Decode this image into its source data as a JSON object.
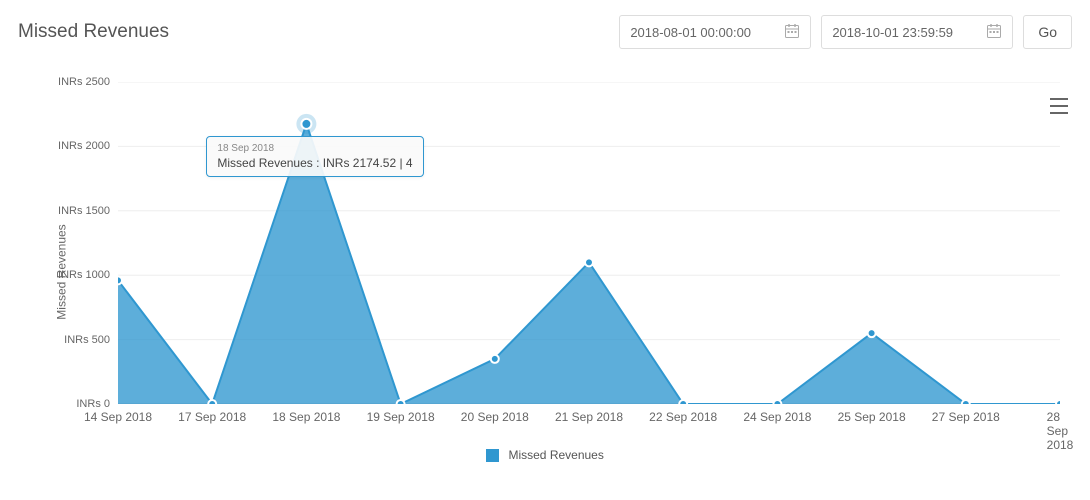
{
  "header": {
    "title": "Missed Revenues"
  },
  "controls": {
    "date_from": "2018-08-01 00:00:00",
    "date_to": "2018-10-01 23:59:59",
    "go_label": "Go"
  },
  "menu_icon": "hamburger-icon",
  "chart_data": {
    "type": "area",
    "title": "",
    "ylabel": "Missed Revenues",
    "ylim": [
      0,
      2500
    ],
    "yticks": [
      "INRs 0",
      "INRs 500",
      "INRs 1000",
      "INRs 1500",
      "INRs 2000",
      "INRs 2500"
    ],
    "categories": [
      "14 Sep 2018",
      "17 Sep 2018",
      "18 Sep 2018",
      "19 Sep 2018",
      "20 Sep 2018",
      "21 Sep 2018",
      "22 Sep 2018",
      "24 Sep 2018",
      "25 Sep 2018",
      "27 Sep 2018",
      "28 Sep 2018"
    ],
    "series": [
      {
        "name": "Missed Revenues",
        "color": "#2f97d0",
        "values": [
          960,
          0,
          2174.52,
          0,
          350,
          1100,
          0,
          0,
          550,
          0,
          0
        ]
      }
    ],
    "legend": {
      "position": "bottom"
    }
  },
  "tooltip": {
    "visible_index": 2,
    "date": "18 Sep 2018",
    "line": "Missed Revenues : INRs 2174.52 | 4"
  }
}
